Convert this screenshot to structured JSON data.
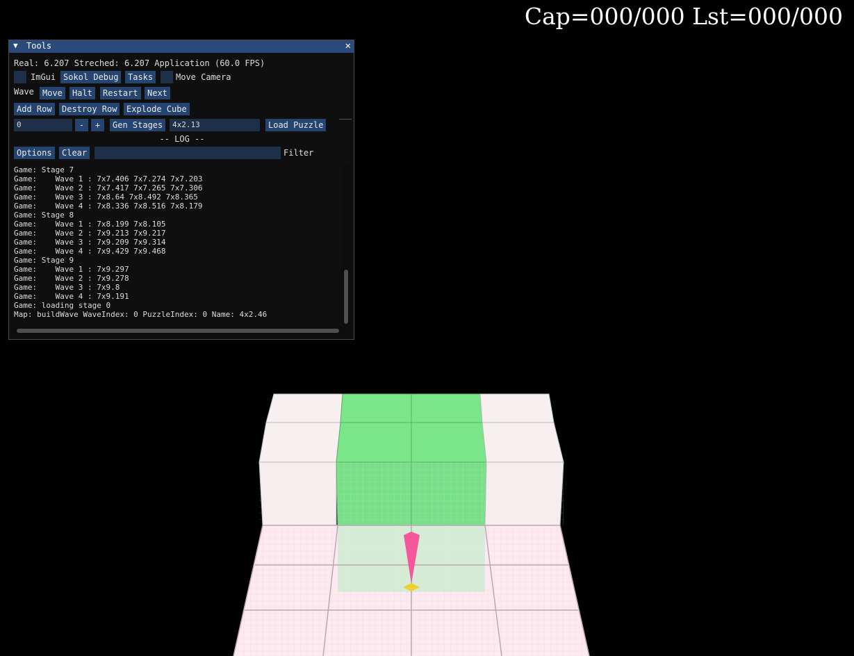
{
  "hud": {
    "counters": "Cap=000/000 Lst=000/000"
  },
  "colors": {
    "titlebar": "#294a7a",
    "button": "#254570",
    "tile_white": "#f7f0f0",
    "tile_green": "#7be58a",
    "floor_pink": "#fce8ee",
    "player": "#f4589a",
    "marker": "#f0d030"
  },
  "tools": {
    "title": "Tools",
    "collapse_icon": "▼",
    "close_icon": "✕",
    "status": "Real: 6.207 Streched: 6.207 Application (60.0 FPS)",
    "row1": {
      "imgui_label": "ImGui",
      "sokol_debug": "Sokol Debug",
      "tasks": "Tasks",
      "move_camera_label": "Move Camera"
    },
    "row2": {
      "wave_label": "Wave",
      "move": "Move",
      "halt": "Halt",
      "restart": "Restart",
      "next": "Next"
    },
    "row3": {
      "add_row": "Add Row",
      "destroy_row": "Destroy Row",
      "explode_cube": "Explode Cube"
    },
    "row4": {
      "stage_value": "0",
      "minus": "-",
      "plus": "+",
      "gen_stages": "Gen Stages",
      "puzzle_value": "4x2.13",
      "load_puzzle": "Load Puzzle"
    },
    "log_header": "-- LOG --",
    "row5": {
      "options": "Options",
      "clear": "Clear",
      "filter_value": "",
      "filter_label": "Filter"
    },
    "log_lines": [
      "Game: Stage 7",
      "Game:    Wave 1 : 7x7.406 7x7.274 7x7.203",
      "Game:    Wave 2 : 7x7.417 7x7.265 7x7.306",
      "Game:    Wave 3 : 7x8.64 7x8.492 7x8.365",
      "Game:    Wave 4 : 7x8.336 7x8.516 7x8.179",
      "Game: Stage 8",
      "Game:    Wave 1 : 7x8.199 7x8.105",
      "Game:    Wave 2 : 7x9.213 7x9.217",
      "Game:    Wave 3 : 7x9.209 7x9.314",
      "Game:    Wave 4 : 7x9.429 7x9.468",
      "Game: Stage 9",
      "Game:    Wave 1 : 7x9.297",
      "Game:    Wave 2 : 7x9.278",
      "Game:    Wave 3 : 7x9.8",
      "Game:    Wave 4 : 7x9.191",
      "Game: loading stage 0",
      "Map: buildWave WaveIndex: 0 PuzzleIndex: 0 Name: 4x2.46"
    ]
  }
}
